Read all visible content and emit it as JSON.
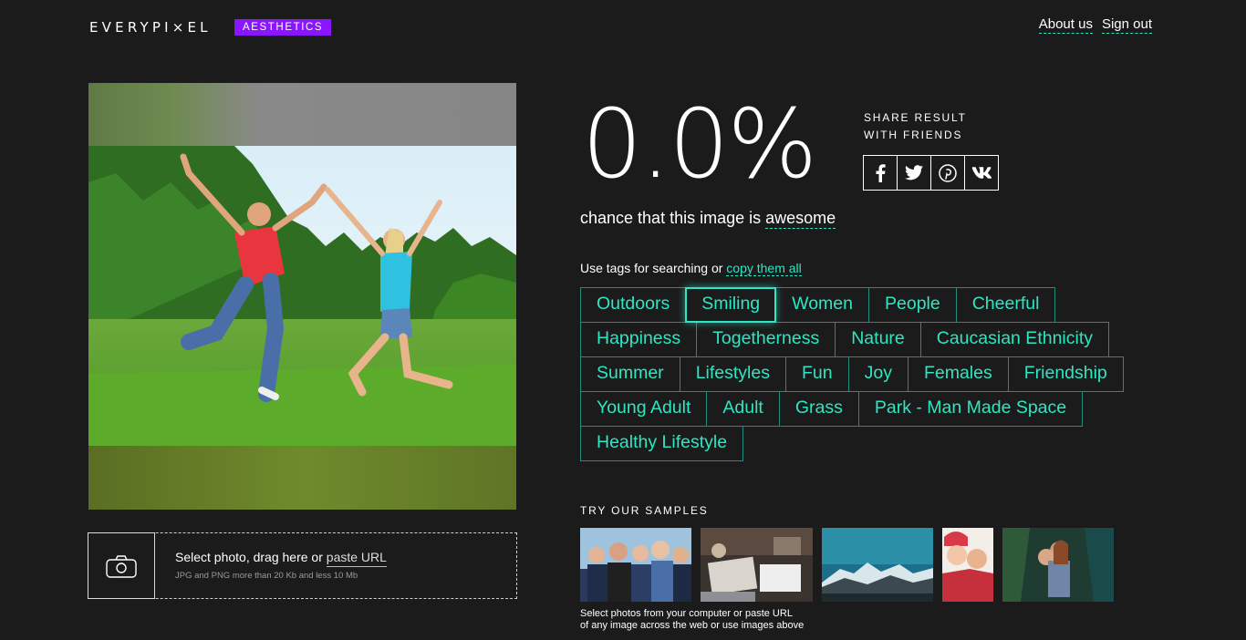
{
  "header": {
    "logo": "EVERYPI×EL",
    "badge": "AESTHETICS",
    "nav": [
      "About us",
      "Sign out"
    ]
  },
  "upload": {
    "main_prefix": "Select photo, drag here or ",
    "main_link": "paste URL",
    "sub": "JPG and PNG more than 20 Kb and less 10 Mb"
  },
  "result": {
    "score": "0.0%",
    "chance_prefix": "chance that this image is ",
    "chance_word": "awesome"
  },
  "share": {
    "line1": "SHARE RESULT",
    "line2": "WITH FRIENDS",
    "buttons": [
      "facebook-icon",
      "twitter-icon",
      "pinterest-icon",
      "vk-icon"
    ]
  },
  "tags": {
    "intro_prefix": "Use tags for searching or ",
    "intro_link": "copy them all",
    "rows": [
      [
        "Outdoors",
        "Smiling",
        "Women",
        "People",
        "Cheerful"
      ],
      [
        "Happiness",
        "Togetherness",
        "Nature",
        "Caucasian Ethnicity"
      ],
      [
        "Summer",
        "Lifestyles",
        "Fun",
        "Joy",
        "Females",
        "Friendship"
      ],
      [
        "Young Adult",
        "Adult",
        "Grass",
        "Park - Man Made Space"
      ],
      [
        "Healthy Lifestyle"
      ]
    ],
    "active": "Smiling"
  },
  "samples": {
    "title": "TRY OUR SAMPLES",
    "note_line1": "Select photos from your computer or paste URL",
    "note_line2": "of any image across the web or use images above"
  },
  "colors": {
    "background": "#1b1b1b",
    "accent": "#2ee6c4",
    "badge": "#8a16ff"
  }
}
